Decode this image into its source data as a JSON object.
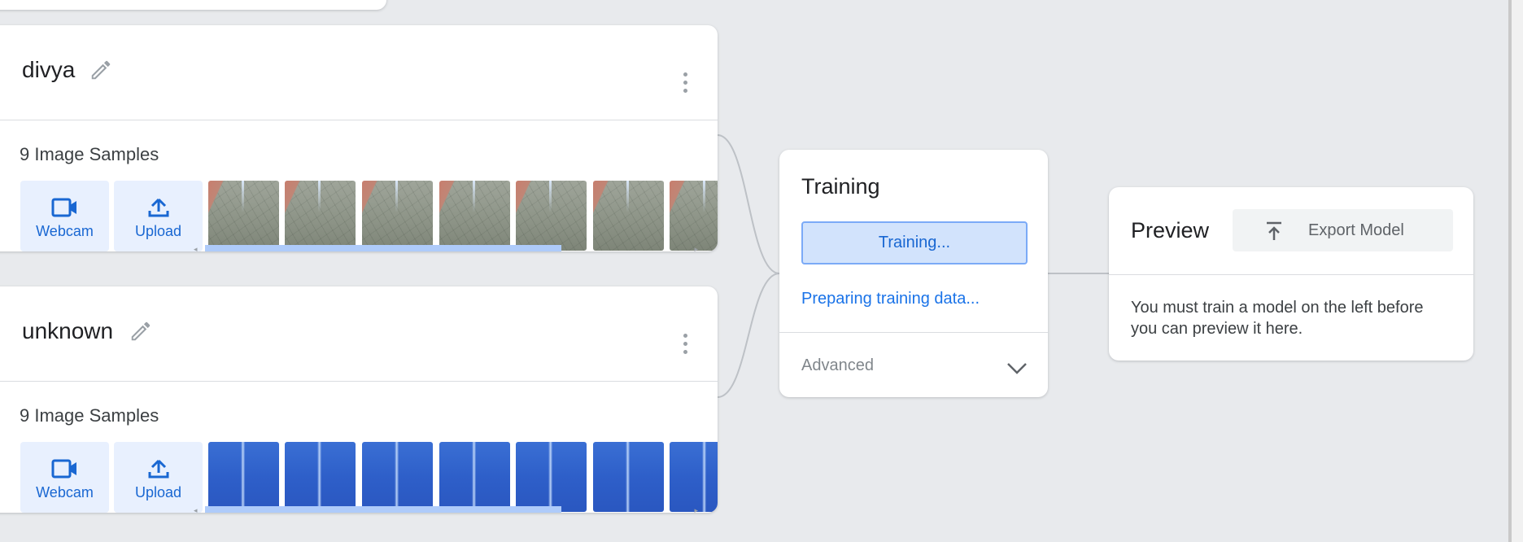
{
  "classes": [
    {
      "name": "divya",
      "samples_label": "9 Image Samples",
      "webcam_label": "Webcam",
      "upload_label": "Upload",
      "thumbnail_style": "leaf"
    },
    {
      "name": "unknown",
      "samples_label": "9 Image Samples",
      "webcam_label": "Webcam",
      "upload_label": "Upload",
      "thumbnail_style": "blue"
    }
  ],
  "training": {
    "title": "Training",
    "button_label": "Training...",
    "status_text": "Preparing training data...",
    "advanced_label": "Advanced"
  },
  "preview": {
    "title": "Preview",
    "export_label": "Export Model",
    "message": "You must train a model on the left before you can preview it here."
  },
  "colors": {
    "background": "#e8eaed",
    "accent": "#1a73e8",
    "button_tint": "#e8f0fe",
    "scroll_thumb": "#aecbfa"
  }
}
